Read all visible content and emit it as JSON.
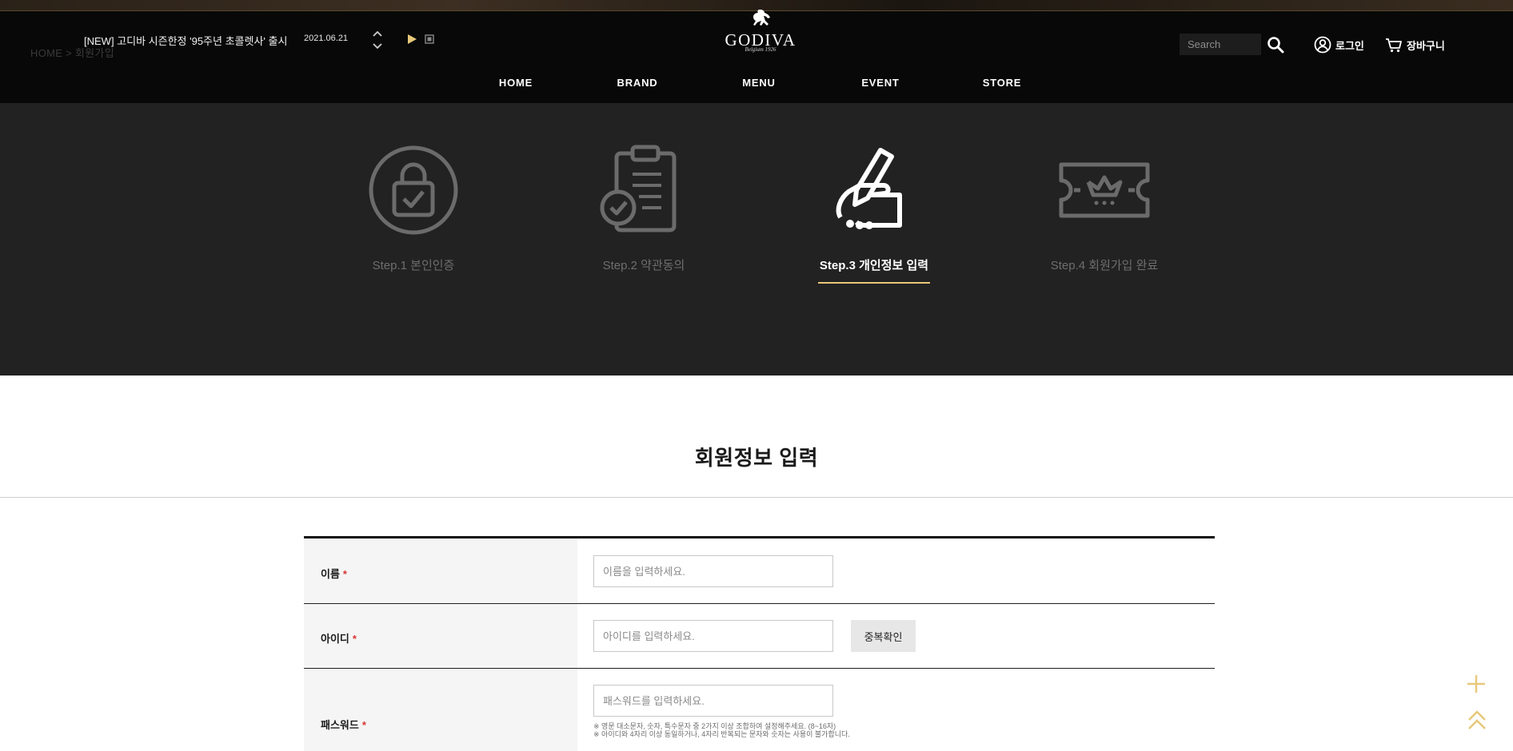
{
  "header": {
    "breadcrumb": "HOME > 회원가입",
    "notice": {
      "text": "[NEW] 고디바 시즌한정 '95주년 초콜렛사' 출시",
      "date": "2021.06.21"
    },
    "logo": {
      "brand": "GODIVA",
      "tagline": "Belgium 1926"
    },
    "search_placeholder": "Search",
    "login_label": "로그인",
    "cart_label": "장바구니",
    "nav": [
      "HOME",
      "BRAND",
      "MENU",
      "EVENT",
      "STORE"
    ]
  },
  "steps": [
    {
      "label": "Step.1 본인인증",
      "icon": "lock-check-icon",
      "active": false
    },
    {
      "label": "Step.2 약관동의",
      "icon": "clipboard-check-icon",
      "active": false
    },
    {
      "label": "Step.3 개인정보 입력",
      "icon": "hand-writing-icon",
      "active": true
    },
    {
      "label": "Step.4 회원가입 완료",
      "icon": "crown-ticket-icon",
      "active": false
    }
  ],
  "section_title": "회원정보 입력",
  "form": {
    "name": {
      "label": "이름",
      "required_mark": "*",
      "placeholder": "이름을 입력하세요."
    },
    "user_id": {
      "label": "아이디",
      "required_mark": "*",
      "placeholder": "아이디를 입력하세요.",
      "check_button": "중복확인"
    },
    "password": {
      "label": "패스워드",
      "required_mark": "*",
      "placeholder": "패스워드를 입력하세요.",
      "hints": [
        "※ 영문 대소문자, 숫자, 특수문자 중 2가지 이상 조합하여 설정해주세요. (8~16자)",
        "※ 아이디와 4자리 이상 동일하거나, 4자리 반복되는 문자와 숫자는 사용이 불가합니다."
      ]
    }
  },
  "colors": {
    "accent": "#e8c87a",
    "required": "#d33333",
    "band": "#222222",
    "header": "#080808"
  }
}
